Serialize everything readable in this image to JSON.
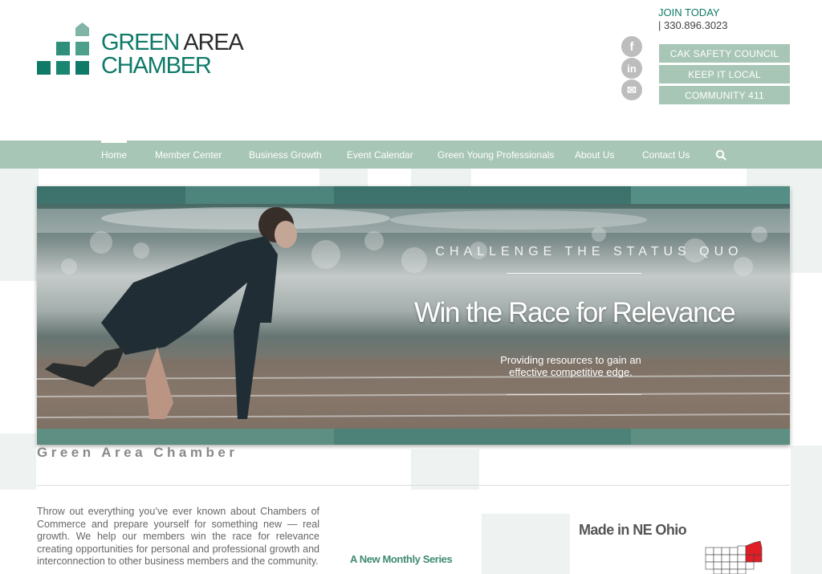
{
  "header": {
    "logo": {
      "line1_a": "GREEN",
      "line1_b": "AREA",
      "line2": "CHAMBER"
    },
    "join_label": "JOIN TODAY",
    "phone": "| 330.896.3023",
    "social": [
      {
        "icon": "facebook-icon",
        "glyph": "f"
      },
      {
        "icon": "linkedin-icon",
        "glyph": "in"
      },
      {
        "icon": "mail-icon",
        "glyph": "✉"
      }
    ],
    "quick_links": [
      "CAK SAFETY COUNCIL",
      "KEEP IT LOCAL",
      "COMMUNITY 411"
    ]
  },
  "nav": {
    "items": [
      "Home",
      "Member Center",
      "Business Growth",
      "Event Calendar",
      "Green Young Professionals",
      "About Us",
      "Contact Us"
    ],
    "active": "Home",
    "search_icon": "search-icon"
  },
  "hero": {
    "kicker": "CHALLENGE THE STATUS QUO",
    "title": "Win the Race for Relevance",
    "subtitle": "Providing resources to gain an effective competitive edge."
  },
  "content": {
    "section_title": "Green Area Chamber",
    "intro": "Throw out everything you’ve ever known about Chambers of Commerce and prepare yourself for something new — real growth.  We help our members win the race for relevance creating opportunities for personal and professional growth and interconnection to other business members and the community.",
    "series_heading": "A New Monthly Series",
    "made_heading": "Made in NE Ohio"
  },
  "colors": {
    "brand_green": "#0f7a68",
    "nav_bg": "#a8c6b6",
    "button_bg": "#a8c6b6",
    "series_green": "#3f8a72"
  }
}
